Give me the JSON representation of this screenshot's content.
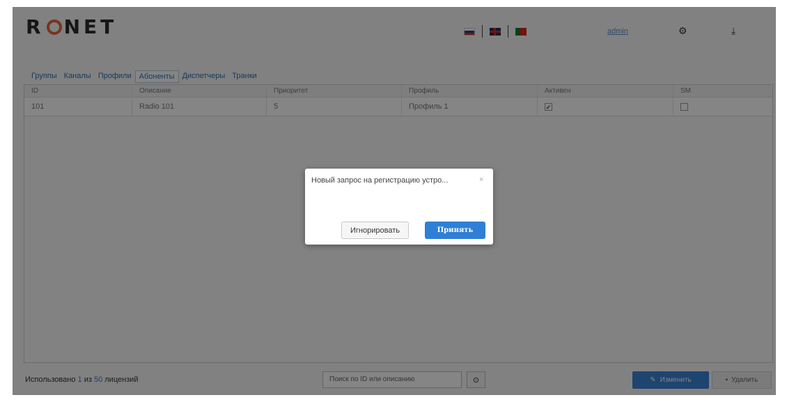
{
  "header": {
    "logo": "RONET",
    "user_link": "admin",
    "languages": [
      "ru-flag",
      "gb-flag",
      "pt-flag"
    ],
    "icons": [
      "gear-icon",
      "download-icon"
    ]
  },
  "tabs": [
    {
      "label": "Группы",
      "active": false
    },
    {
      "label": "Каналы",
      "active": false
    },
    {
      "label": "Профили",
      "active": false
    },
    {
      "label": "Абоненты",
      "active": true
    },
    {
      "label": "Диспетчеры",
      "active": false
    },
    {
      "label": "Транки",
      "active": false
    }
  ],
  "table": {
    "headers": [
      "ID",
      "Описание",
      "Приоритет",
      "Профиль",
      "Активен",
      "SM"
    ],
    "rows": [
      {
        "id": "101",
        "description": "Radio 101",
        "priority": "5",
        "profile": "Профиль 1",
        "active": true,
        "sm": false
      }
    ]
  },
  "footer": {
    "used_prefix": "Использовано ",
    "used_count": "1",
    "used_middle": " из ",
    "license_total": "50",
    "used_suffix": " лицензий",
    "search_placeholder": "Поиск по ID или описанию",
    "change_label": "Изменить",
    "delete_label": "Удалить"
  },
  "modal": {
    "title": "Новый запрос на регистрацию устро...",
    "close": "×",
    "ignore_label": "Игнорировать",
    "accept_label": "Принять"
  },
  "colors": {
    "accent": "#2f7fd6",
    "logo_o": "#e8623a",
    "overlay": "rgba(0,0,0,0.48)"
  }
}
